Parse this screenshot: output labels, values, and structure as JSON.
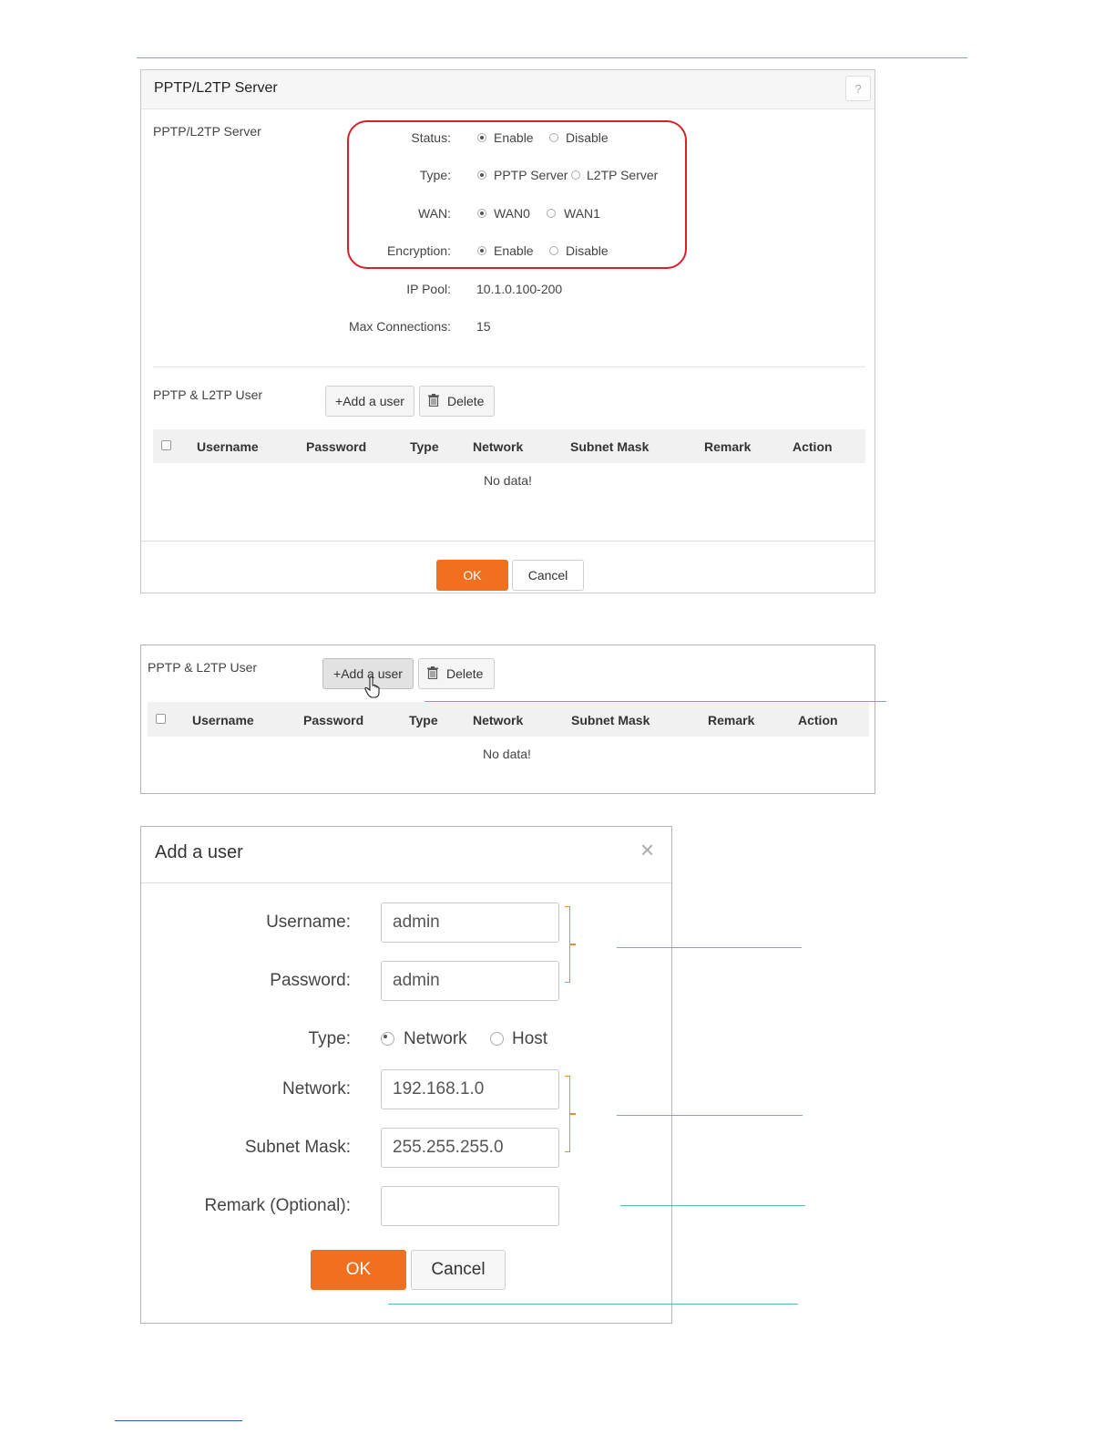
{
  "server_panel": {
    "title": "PPTP/L2TP Server",
    "help": "?",
    "section_label": "PPTP/L2TP Server",
    "status_label": "Status:",
    "status_options": [
      "Enable",
      "Disable"
    ],
    "type_label": "Type:",
    "type_options": [
      "PPTP Server",
      "L2TP Server"
    ],
    "wan_label": "WAN:",
    "wan_options": [
      "WAN0",
      "WAN1"
    ],
    "encryption_label": "Encryption:",
    "encryption_options": [
      "Enable",
      "Disable"
    ],
    "ip_pool_label": "IP Pool:",
    "ip_pool_value": "10.1.0.100-200",
    "max_conn_label": "Max Connections:",
    "max_conn_value": "15",
    "user_section_label": "PPTP & L2TP User",
    "add_user": "+Add a user",
    "delete": "Delete",
    "columns": [
      "Username",
      "Password",
      "Type",
      "Network",
      "Subnet Mask",
      "Remark",
      "Action"
    ],
    "no_data": "No data!",
    "ok": "OK",
    "cancel": "Cancel"
  },
  "user_panel": {
    "section_label": "PPTP & L2TP User",
    "add_user": "+Add a user",
    "delete": "Delete",
    "columns": [
      "Username",
      "Password",
      "Type",
      "Network",
      "Subnet Mask",
      "Remark",
      "Action"
    ],
    "no_data": "No data!"
  },
  "dialog": {
    "title": "Add a user",
    "close": "×",
    "username_label": "Username:",
    "username_value": "admin",
    "password_label": "Password:",
    "password_value": "admin",
    "type_label": "Type:",
    "type_options": [
      "Network",
      "Host"
    ],
    "network_label": "Network:",
    "network_value": "192.168.1.0",
    "mask_label": "Subnet Mask:",
    "mask_value": "255.255.255.0",
    "remark_label": "Remark (Optional):",
    "remark_value": "",
    "ok": "OK",
    "cancel": "Cancel"
  },
  "colors": {
    "accent": "#f07020",
    "highlight_box": "#d9202a",
    "callout_line": "#5fb3c7",
    "bracket": "#f08a30"
  }
}
